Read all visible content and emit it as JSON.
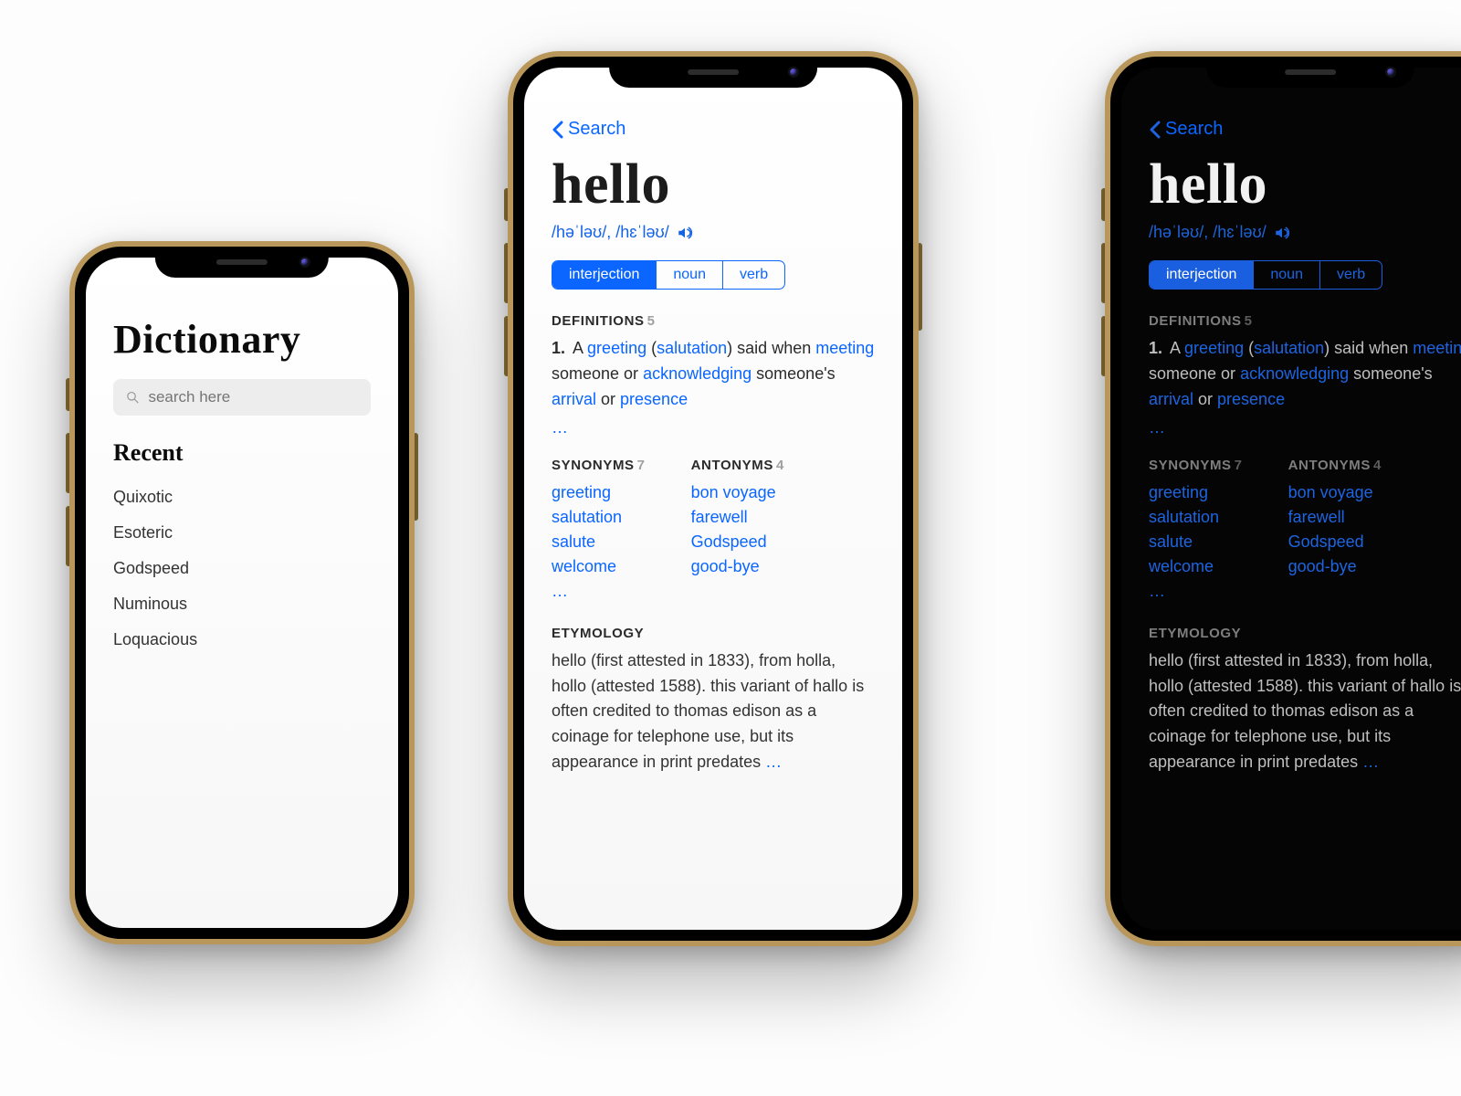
{
  "colors": {
    "accent": "#0a66ff",
    "gold": "#b9975b"
  },
  "screen1": {
    "title": "Dictionary",
    "search_placeholder": "search here",
    "recent_heading": "Recent",
    "recent": [
      "Quixotic",
      "Esoteric",
      "Godspeed",
      "Numinous",
      "Loquacious"
    ]
  },
  "screen2": {
    "back_label": "Search",
    "word": "hello",
    "pronunciation": "/həˈləʊ/, /hɛˈləʊ/",
    "sound_icon": "speaker-icon",
    "parts_of_speech": [
      "interjection",
      "noun",
      "verb"
    ],
    "active_pos": "interjection",
    "definitions_heading": "DEFINITIONS",
    "definitions_count": "5",
    "definition_1": {
      "number": "1.",
      "tokens": [
        {
          "t": " A "
        },
        {
          "t": "greeting",
          "link": true
        },
        {
          "t": " ("
        },
        {
          "t": "salutation",
          "link": true
        },
        {
          "t": ") said when "
        },
        {
          "t": "meeting",
          "link": true
        },
        {
          "t": " someone or "
        },
        {
          "t": "acknowledging",
          "link": true
        },
        {
          "t": " someone's "
        },
        {
          "t": "arrival",
          "link": true
        },
        {
          "t": " or "
        },
        {
          "t": "presence",
          "link": true
        }
      ]
    },
    "more_ellipsis": "…",
    "synonyms_heading": "SYNONYMS",
    "synonyms_count": "7",
    "synonyms": [
      "greeting",
      "salutation",
      "salute",
      "welcome",
      "…"
    ],
    "antonyms_heading": "ANTONYMS",
    "antonyms_count": "4",
    "antonyms": [
      "bon voyage",
      "farewell",
      "Godspeed",
      "good-bye"
    ],
    "etymology_heading": "ETYMOLOGY",
    "etymology_text": "hello (first attested in 1833), from holla, hollo (attested 1588). this variant of hallo is often credited to thomas edison as a coinage for telephone use, but its appearance in print predates ",
    "etymology_more": "…"
  },
  "screen3_mode": "dark"
}
